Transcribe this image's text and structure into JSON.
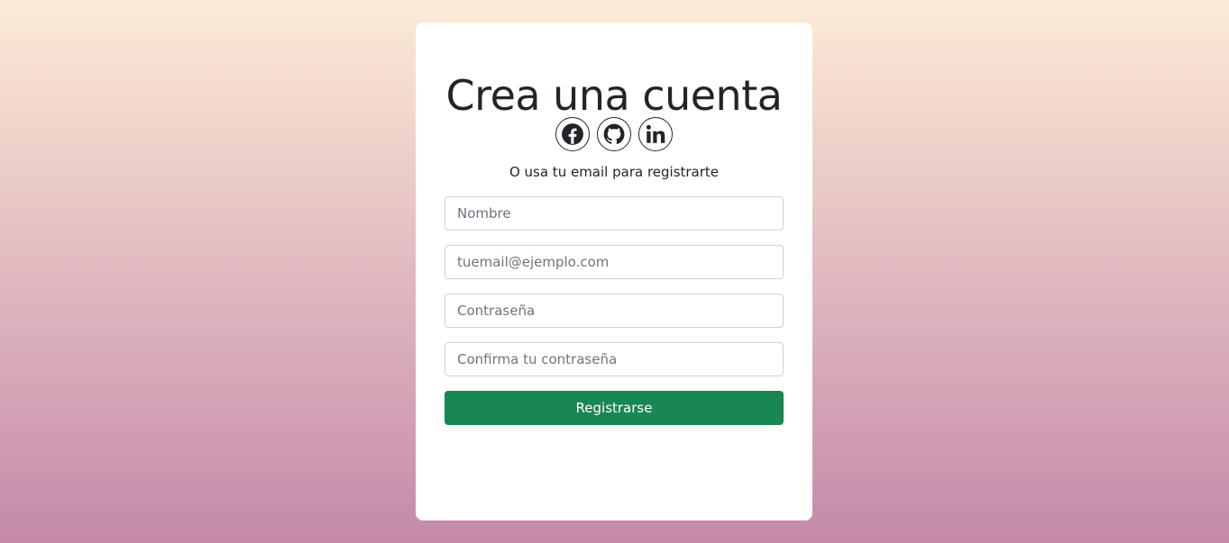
{
  "form": {
    "title": "Crea una cuenta",
    "social_buttons": [
      {
        "icon": "facebook-icon"
      },
      {
        "icon": "github-icon"
      },
      {
        "icon": "linkedin-icon"
      }
    ],
    "subtitle": "O usa tu email para registrarte",
    "fields": {
      "name": {
        "placeholder": "Nombre",
        "value": ""
      },
      "email": {
        "placeholder": "tuemail@ejemplo.com",
        "value": ""
      },
      "password": {
        "placeholder": "Contraseña",
        "value": ""
      },
      "confirm_password": {
        "placeholder": "Confirma tu contraseña",
        "value": ""
      }
    },
    "submit_label": "Registrarse"
  },
  "colors": {
    "background_top": "#fdebd6",
    "background_bottom": "#c48aa8",
    "card": "#ffffff",
    "primary_button": "#198754",
    "text": "#212529"
  }
}
